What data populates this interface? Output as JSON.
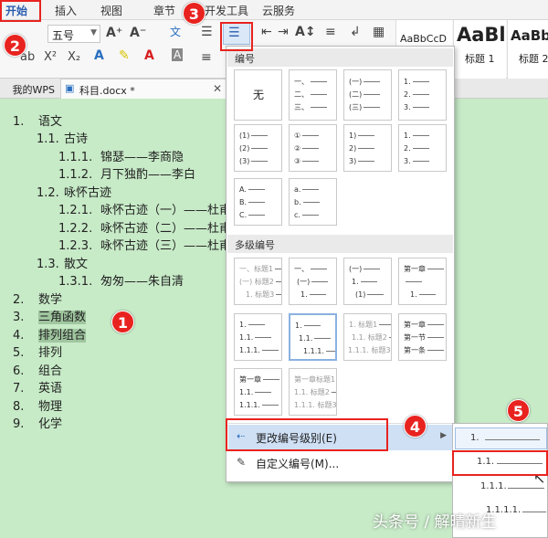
{
  "ribbon": {
    "tabs": [
      {
        "label": "开始"
      },
      {
        "label": "插入"
      },
      {
        "label": "页面布局"
      },
      {
        "label": "视图"
      },
      {
        "label": "章节"
      },
      {
        "label": "开发工具"
      },
      {
        "label": "云服务"
      }
    ],
    "font_size": "五号",
    "styles": [
      {
        "sample": "AaBbCcD",
        "name": ""
      },
      {
        "sample": "AaBl",
        "name": "标题 1"
      },
      {
        "sample": "AaBb",
        "name": "标题 2"
      }
    ]
  },
  "doc_tabs": [
    {
      "label": "我的WPS"
    },
    {
      "label": "科目.docx *"
    }
  ],
  "document": {
    "lines": [
      {
        "num": "1.",
        "text": "语文"
      },
      {
        "num": "1.1.",
        "text": "古诗"
      },
      {
        "num": "1.1.1.",
        "text": "锦瑟——李商隐"
      },
      {
        "num": "1.1.2.",
        "text": "月下独酌——李白"
      },
      {
        "num": "1.2.",
        "text": "咏怀古迹"
      },
      {
        "num": "1.2.1.",
        "text": "咏怀古迹（一）——杜甫"
      },
      {
        "num": "1.2.2.",
        "text": "咏怀古迹（二）——杜甫"
      },
      {
        "num": "1.2.3.",
        "text": "咏怀古迹（三）——杜甫"
      },
      {
        "num": "1.3.",
        "text": "散文"
      },
      {
        "num": "1.3.1.",
        "text": "匆匆——朱自清"
      },
      {
        "num": "2.",
        "text": "数学"
      },
      {
        "num": "3.",
        "text": "三角函数"
      },
      {
        "num": "4.",
        "text": "排列组合"
      },
      {
        "num": "5.",
        "text": "排列"
      },
      {
        "num": "6.",
        "text": "组合"
      },
      {
        "num": "7.",
        "text": "英语"
      },
      {
        "num": "8.",
        "text": "物理"
      },
      {
        "num": "9.",
        "text": "化学"
      }
    ]
  },
  "numbering_menu": {
    "section_numbering": "编号",
    "none_label": "无",
    "section_multilevel": "多级编号",
    "change_level": "更改编号级别(E)",
    "custom": "自定义编号(M)...",
    "single": [
      [
        "一、",
        "二、",
        "三、"
      ],
      [
        "(一)",
        "(二)",
        "(三)"
      ],
      [
        "1.",
        "2.",
        "3."
      ],
      [
        "(1)",
        "(2)",
        "(3)"
      ],
      [
        "①",
        "②",
        "③"
      ],
      [
        "1)",
        "2)",
        "3)"
      ],
      [
        "1.",
        "2.",
        "3."
      ],
      [
        "A.",
        "B.",
        "C."
      ],
      [
        "a.",
        "b.",
        "c."
      ]
    ],
    "multi": [
      [
        "一、标题1",
        "(一) 标题2",
        "1. 标题3"
      ],
      [
        "一、",
        "(一)",
        "1."
      ],
      [
        "(一)",
        "1.",
        "(1)"
      ],
      [
        "第一章",
        "",
        "1."
      ],
      [
        "1.",
        "1.1.",
        "1.1.1."
      ],
      [
        "1.",
        "1.1.",
        "1.1.1."
      ],
      [
        "1. 标题1",
        "1.1. 标题2",
        "1.1.1. 标题3"
      ],
      [
        "第一章",
        "第一节",
        "第一条"
      ],
      [
        "第一章",
        "1.1.",
        "1.1.1."
      ],
      [
        "第一章标题1",
        "1.1. 标题2",
        "1.1.1. 标题3"
      ]
    ]
  },
  "level_submenu": [
    "1.",
    "1.1.",
    "1.1.1.",
    "1.1.1.1."
  ],
  "markers": [
    "1",
    "2",
    "3",
    "4",
    "5"
  ],
  "watermark": "头条号 / 解晴新生",
  "colors": {
    "accent_red": "#e8231f",
    "doc_bg": "#c7eac7",
    "highlight": "#9fc69f"
  }
}
